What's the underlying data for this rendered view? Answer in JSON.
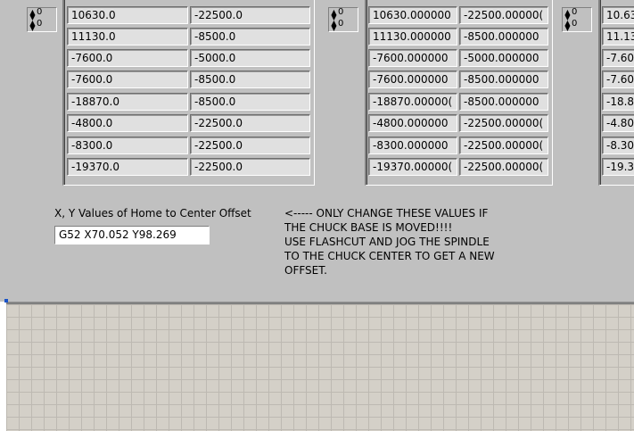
{
  "arrays": [
    {
      "index": [
        "0",
        "0"
      ],
      "col1": [
        "10630.0",
        "11130.0",
        "-7600.0",
        "-7600.0",
        "-18870.0",
        "-4800.0",
        "-8300.0",
        "-19370.0"
      ],
      "col2": [
        "-22500.0",
        "-8500.0",
        "-5000.0",
        "-8500.0",
        "-8500.0",
        "-22500.0",
        "-22500.0",
        "-22500.0"
      ]
    },
    {
      "index": [
        "0",
        "0"
      ],
      "col1": [
        "10630.000000",
        "11130.000000",
        "-7600.000000",
        "-7600.000000",
        "-18870.00000(",
        "-4800.000000",
        "-8300.000000",
        "-19370.00000("
      ],
      "col2": [
        "-22500.00000(",
        "-8500.000000",
        "-5000.000000",
        "-8500.000000",
        "-8500.000000",
        "-22500.00000(",
        "-22500.00000(",
        "-22500.00000("
      ]
    },
    {
      "index": [
        "0",
        "0"
      ],
      "col1": [
        "10.63",
        "11.13",
        "-7.60",
        "-7.60",
        "-18.8",
        "-4.80",
        "-8.30",
        "-19.3"
      ]
    }
  ],
  "home_offset": {
    "label": "X, Y Values of Home to Center Offset",
    "value": "G52 X70.052 Y98.269"
  },
  "warning": {
    "lines": [
      "<----- ONLY CHANGE THESE VALUES IF",
      "THE CHUCK BASE IS MOVED!!!!",
      "USE FLASHCUT AND JOG THE SPINDLE",
      "TO THE CHUCK CENTER TO GET A NEW",
      "OFFSET."
    ]
  },
  "colors": {
    "panel": "#c0c0c0",
    "grid_bg": "#d4d0c8",
    "cell_bg": "#e0e0e0",
    "selection_marker": "#1a53c8"
  }
}
